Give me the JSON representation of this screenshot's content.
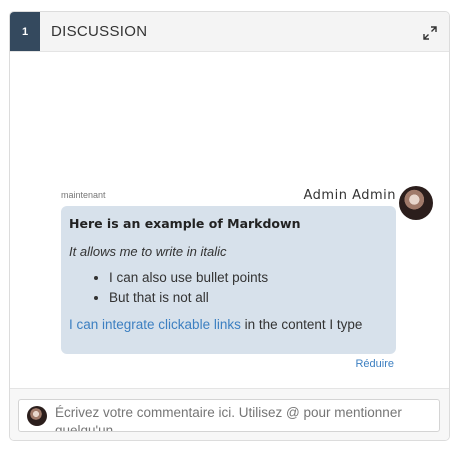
{
  "panel": {
    "step_number": "1",
    "title": "DISCUSSION",
    "expand_icon": "expand-icon"
  },
  "comment": {
    "timestamp": "maintenant",
    "author": "Admin Admin",
    "avatar_icon": "avatar",
    "message": {
      "heading": "Here is an example of Markdown",
      "italic_text": "It allows me to write in italic",
      "bullets": [
        "I can also use bullet points",
        "But that is not all"
      ],
      "link_text": "I can integrate clickable links",
      "trailing_text": " in the content I type"
    },
    "collapse_label": "Réduire"
  },
  "composer": {
    "placeholder": "Écrivez votre commentaire ici. Utilisez @ pour mentionner quelqu'un"
  },
  "colors": {
    "badge_bg": "#34495e",
    "bubble_bg": "#d7e1eb",
    "link": "#3c7fc1"
  }
}
